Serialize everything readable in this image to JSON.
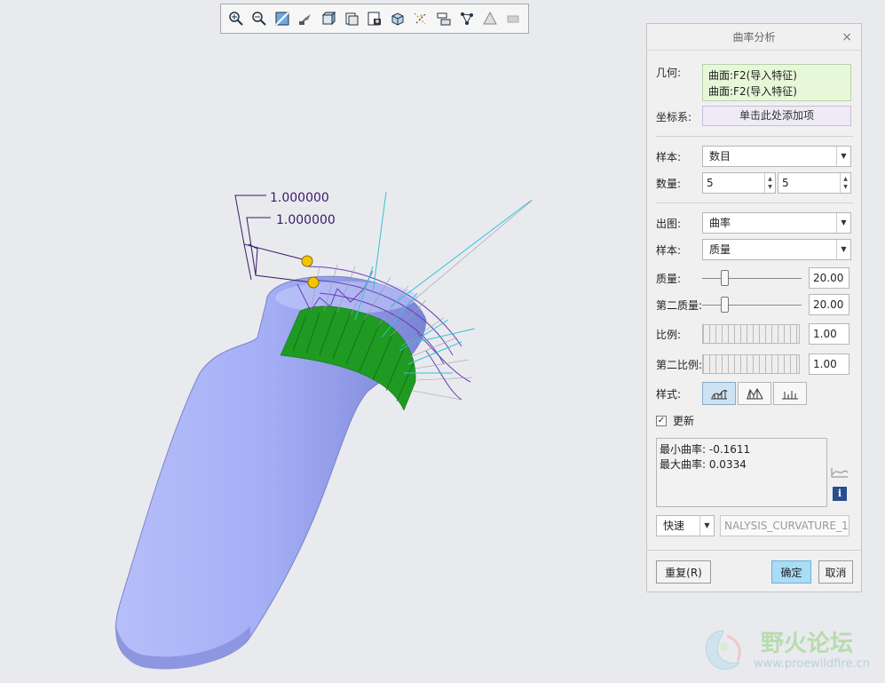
{
  "toolbar": {
    "icons": [
      "zoom-in-icon",
      "zoom-out-icon",
      "refit-icon",
      "orient-icon",
      "display-style-icon",
      "saved-views-icon",
      "view-manager-icon",
      "perspective-icon",
      "datum-display-icon",
      "annotation-display-icon",
      "spin-center-icon",
      "appearance-icon"
    ]
  },
  "viewport": {
    "dim1": "1.000000",
    "dim2": "1.000000"
  },
  "dialog": {
    "title": "曲率分析",
    "close": "×",
    "geometry_label": "几何:",
    "geometry_items": [
      "曲面:F2(导入特征)",
      "曲面:F2(导入特征)"
    ],
    "coord_label": "坐标系:",
    "coord_placeholder": "单击此处添加项",
    "sample_label": "样本:",
    "sample_value": "数目",
    "count_label": "数量:",
    "count_u": "5",
    "count_v": "5",
    "plot_label": "出图:",
    "plot_value": "曲率",
    "sample2_label": "样本:",
    "sample2_value": "质量",
    "quality_label": "质量:",
    "quality_value": "20.00",
    "quality2_label": "第二质量:",
    "quality2_value": "20.00",
    "scale_label": "比例:",
    "scale_value": "1.00",
    "scale2_label": "第二比例:",
    "scale2_value": "1.00",
    "style_label": "样式:",
    "update_label": "更新",
    "update_checked": "✓",
    "min_curvature": "最小曲率: -0.1611",
    "max_curvature": "最大曲率: 0.0334",
    "mode_value": "快速",
    "analysis_name": "NALYSIS_CURVATURE_1",
    "repeat_label": "重复(R)",
    "ok_label": "确定",
    "cancel_label": "取消"
  },
  "watermark": {
    "title": "野火论坛",
    "url": "www.proewildfire.cn"
  },
  "colors": {
    "part_fill": "#a4aef5",
    "curvature_green": "#1f9a22",
    "cyan_comb": "#31c3d6",
    "purple_comb": "#6a3fb6",
    "primary_button": "#a9dcf5"
  }
}
